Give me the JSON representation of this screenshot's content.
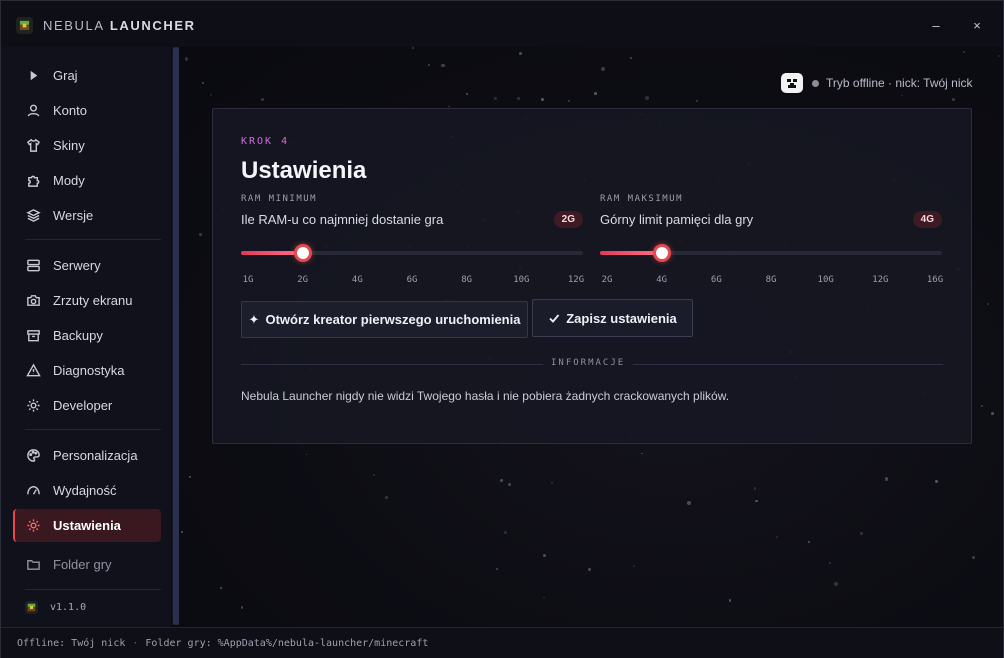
{
  "app": {
    "name_bold": "NEBULA",
    "name_rest": "LAUNCHER",
    "logo_icon": "grass-block-icon",
    "minimize": "–",
    "close": "×"
  },
  "sidebar": {
    "items": [
      {
        "label": "Graj",
        "icon": "play-icon"
      },
      {
        "label": "Konto",
        "icon": "user-icon"
      },
      {
        "label": "Skiny",
        "icon": "shirt-icon"
      },
      {
        "label": "Mody",
        "icon": "puzzle-icon"
      },
      {
        "label": "Wersje",
        "icon": "layers-icon"
      },
      {
        "label": "Serwery",
        "icon": "server-icon"
      },
      {
        "label": "Zrzuty ekranu",
        "icon": "camera-icon"
      },
      {
        "label": "Backupy",
        "icon": "archive-icon"
      },
      {
        "label": "Diagnostyka",
        "icon": "warning-icon"
      },
      {
        "label": "Developer",
        "icon": "sun-gear-icon"
      },
      {
        "label": "Personalizacja",
        "icon": "palette-icon"
      },
      {
        "label": "Wydajność",
        "icon": "gauge-icon"
      },
      {
        "label": "Ustawienia",
        "icon": "settings-sun-icon",
        "active": true
      },
      {
        "label": "Folder gry",
        "icon": "folder-icon"
      }
    ],
    "version": "v1.1.0"
  },
  "status": {
    "badge_icon": "skin-face-icon",
    "text": "Tryb offline · nick: Twój nick"
  },
  "card": {
    "step": "KROK 4",
    "title": "Ustawienia",
    "ram_min": {
      "label": "RAM MINIMUM",
      "description": "Ile RAM-u co najmniej dostanie gra",
      "value": "2G",
      "fraction": 0.18,
      "ticks": [
        "1G",
        "2G",
        "4G",
        "6G",
        "8G",
        "10G",
        "12G"
      ]
    },
    "ram_max": {
      "label": "RAM MAKSIMUM",
      "description": "Górny limit pamięci dla gry",
      "value": "4G",
      "fraction": 0.18,
      "ticks": [
        "2G",
        "4G",
        "6G",
        "8G",
        "10G",
        "12G",
        "16G"
      ]
    },
    "wizard_button": "Otwórz kreator pierwszego uruchomienia",
    "save_button": "Zapisz ustawienia",
    "info_label": "INFORMACJE",
    "info_text": "Nebula Launcher nigdy nie widzi Twojego hasła i nie pobiera żadnych crackowanych plików."
  },
  "footer": {
    "offline": "Offline: Twój nick",
    "folder": "Folder gry: %AppData%/nebula-launcher/minecraft"
  },
  "colors": {
    "accent": "#e5484d",
    "step": "#d46be0",
    "active_bg": "#3a1820"
  }
}
